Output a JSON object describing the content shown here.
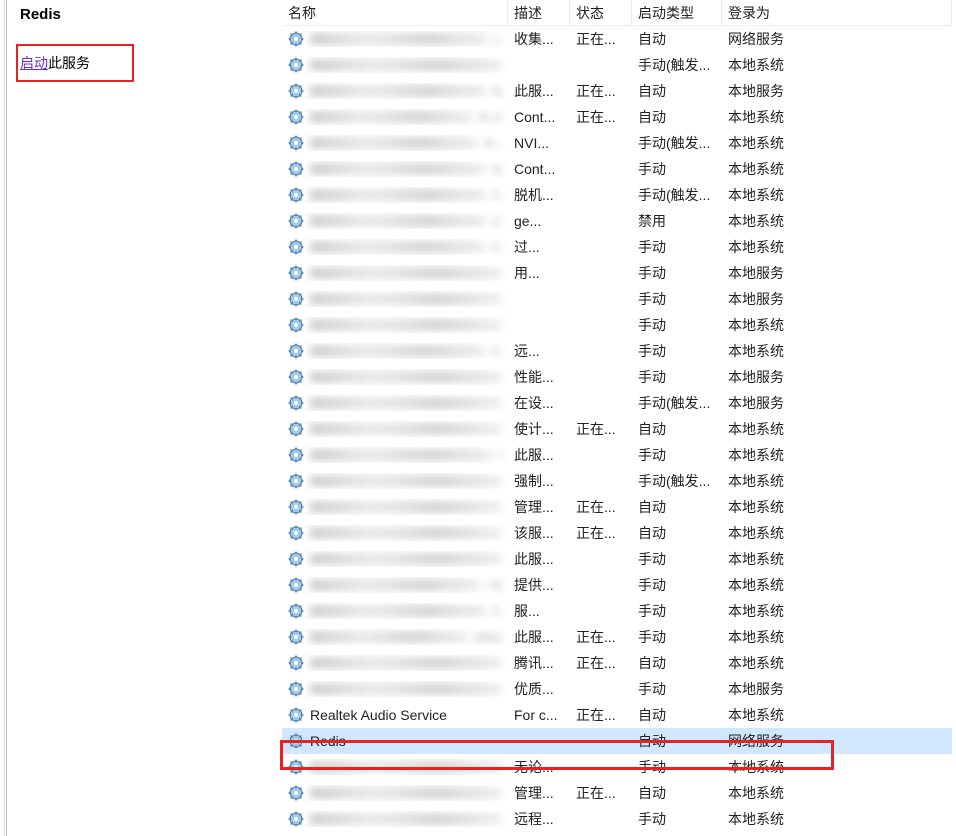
{
  "left": {
    "title": "Redis",
    "start_link": "启动",
    "start_suffix": "此服务"
  },
  "headers": {
    "name": "名称",
    "desc": "描述",
    "status": "状态",
    "startup": "启动类型",
    "logon": "登录为"
  },
  "rows": [
    {
      "name_blur": true,
      "name_hint": "L",
      "desc": "收集...",
      "status": "正在...",
      "startup": "自动",
      "logon": "网络服务"
    },
    {
      "name_blur": true,
      "name_hint": "",
      "desc": "",
      "status": "",
      "startup": "手动(触发...",
      "logon": "本地系统"
    },
    {
      "name_blur": true,
      "name_hint": "N",
      "desc": "此服...",
      "status": "正在...",
      "startup": "自动",
      "logon": "本地服务"
    },
    {
      "name_blur": true,
      "name_hint": "N     S",
      "desc": "Cont...",
      "status": "正在...",
      "startup": "自动",
      "logon": "本地系统"
    },
    {
      "name_blur": true,
      "name_hint": "N     .",
      "desc": "NVI...",
      "status": "",
      "startup": "手动(触发...",
      "logon": "本地系统"
    },
    {
      "name_blur": true,
      "name_hint": "N",
      "desc": "Cont...",
      "status": "",
      "startup": "手动",
      "logon": "本地系统"
    },
    {
      "name_blur": true,
      "name_hint": "C",
      "desc": "脱机...",
      "status": "",
      "startup": "手动(触发...",
      "logon": "本地系统"
    },
    {
      "name_blur": true,
      "name_hint": "C",
      "desc": "ge...",
      "status": "",
      "startup": "禁用",
      "logon": "本地系统"
    },
    {
      "name_blur": true,
      "name_hint": "C",
      "desc": "过...",
      "status": "",
      "startup": "手动",
      "logon": "本地系统"
    },
    {
      "name_blur": true,
      "name_hint": "",
      "desc": "用...",
      "status": "",
      "startup": "手动",
      "logon": "本地服务"
    },
    {
      "name_blur": true,
      "name_hint": "",
      "desc": "",
      "status": "",
      "startup": "手动",
      "logon": "本地服务"
    },
    {
      "name_blur": true,
      "name_hint": "",
      "desc": "",
      "status": "",
      "startup": "手动",
      "logon": "本地系统"
    },
    {
      "name_blur": true,
      "name_hint": "C",
      "desc": "远...",
      "status": "",
      "startup": "手动",
      "logon": "本地系统"
    },
    {
      "name_blur": true,
      "name_hint": "",
      "desc": "性能...",
      "status": "",
      "startup": "手动",
      "logon": "本地服务"
    },
    {
      "name_blur": true,
      "name_hint": "",
      "desc": "在设...",
      "status": "",
      "startup": "手动(触发...",
      "logon": "本地服务"
    },
    {
      "name_blur": true,
      "name_hint": "",
      "desc": "使计...",
      "status": "正在...",
      "startup": "自动",
      "logon": "本地系统"
    },
    {
      "name_blur": true,
      "name_hint": "I",
      "desc": "此服...",
      "status": "",
      "startup": "手动",
      "logon": "本地系统"
    },
    {
      "name_blur": true,
      "name_hint": "",
      "desc": "强制...",
      "status": "",
      "startup": "手动(触发...",
      "logon": "本地系统"
    },
    {
      "name_blur": true,
      "name_hint": "",
      "desc": "管理...",
      "status": "正在...",
      "startup": "自动",
      "logon": "本地系统"
    },
    {
      "name_blur": true,
      "name_hint": "",
      "desc": "该服...",
      "status": "正在...",
      "startup": "自动",
      "logon": "本地系统"
    },
    {
      "name_blur": true,
      "name_hint": "",
      "desc": "此服...",
      "status": "",
      "startup": "手动",
      "logon": "本地系统"
    },
    {
      "name_blur": true,
      "name_hint": "76",
      "desc": "提供...",
      "status": "",
      "startup": "手动",
      "logon": "本地系统"
    },
    {
      "name_blur": true,
      "name_hint": "C",
      "desc": "服...",
      "status": "",
      "startup": "手动",
      "logon": "本地系统"
    },
    {
      "name_blur": true,
      "name_hint": "bility",
      "desc": "此服...",
      "status": "正在...",
      "startup": "手动",
      "logon": "本地系统"
    },
    {
      "name_blur": true,
      "name_hint": "",
      "desc": "腾讯...",
      "status": "正在...",
      "startup": "自动",
      "logon": "本地系统"
    },
    {
      "name_blur": true,
      "name_hint": "",
      "desc": "优质...",
      "status": "",
      "startup": "手动",
      "logon": "本地服务"
    },
    {
      "name": "Realtek Audio Service",
      "desc": "For c...",
      "status": "正在...",
      "startup": "自动",
      "logon": "本地系统"
    },
    {
      "name": "Redis",
      "desc": "",
      "status": "",
      "startup": "自动",
      "logon": "网络服务",
      "selected": true
    },
    {
      "name_blur": true,
      "name_hint": "",
      "desc": "无论...",
      "status": "",
      "startup": "手动",
      "logon": "本地系统"
    },
    {
      "name_blur": true,
      "name_hint": "",
      "desc": "管理...",
      "status": "正在...",
      "startup": "自动",
      "logon": "本地系统"
    },
    {
      "name_blur": true,
      "name_hint": "",
      "desc": "远程...",
      "status": "",
      "startup": "手动",
      "logon": "本地系统"
    }
  ]
}
